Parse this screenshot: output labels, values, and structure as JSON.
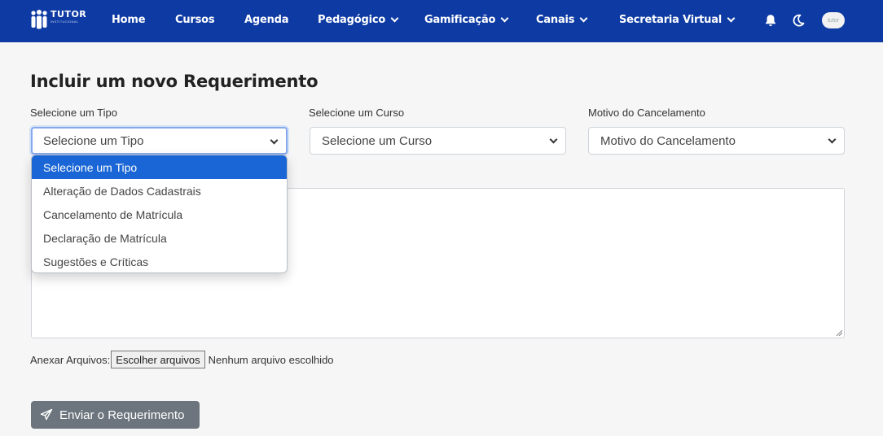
{
  "navbar": {
    "logo_text": "TUTOR",
    "logo_subtext": "INSTITUCIONAL",
    "items": [
      {
        "label": "Home"
      },
      {
        "label": "Cursos"
      },
      {
        "label": "Agenda"
      },
      {
        "label": "Pedagógico"
      },
      {
        "label": "Gamificação"
      },
      {
        "label": "Canais"
      },
      {
        "label": "Secretaria Virtual"
      }
    ],
    "icons": [
      "bell-icon",
      "moon-icon"
    ],
    "avatar_text": "tutor"
  },
  "form": {
    "title": "Incluir um novo Requerimento",
    "tipo": {
      "label": "Selecione um Tipo",
      "value": "Selecione um Tipo"
    },
    "curso": {
      "label": "Selecione um Curso",
      "value": "Selecione um Curso"
    },
    "motivo": {
      "label": "Motivo do Cancelamento",
      "value": "Motivo do Cancelamento"
    },
    "tipo_options": [
      "Selecione um Tipo",
      "Alteração de Dados Cadastrais",
      "Cancelamento de Matrícula",
      "Declaração de Matrícula",
      "Sugestões e Críticas"
    ],
    "attach_label": "Anexar Arquivos:",
    "file_button": "Escolher arquivos",
    "file_status": "Nenhum arquivo escolhido",
    "submit_label": "Enviar o Requerimento"
  },
  "colors": {
    "navbar": "#0d3aa3",
    "selected_option": "#1a66d6",
    "submit_button": "#6c757d"
  }
}
